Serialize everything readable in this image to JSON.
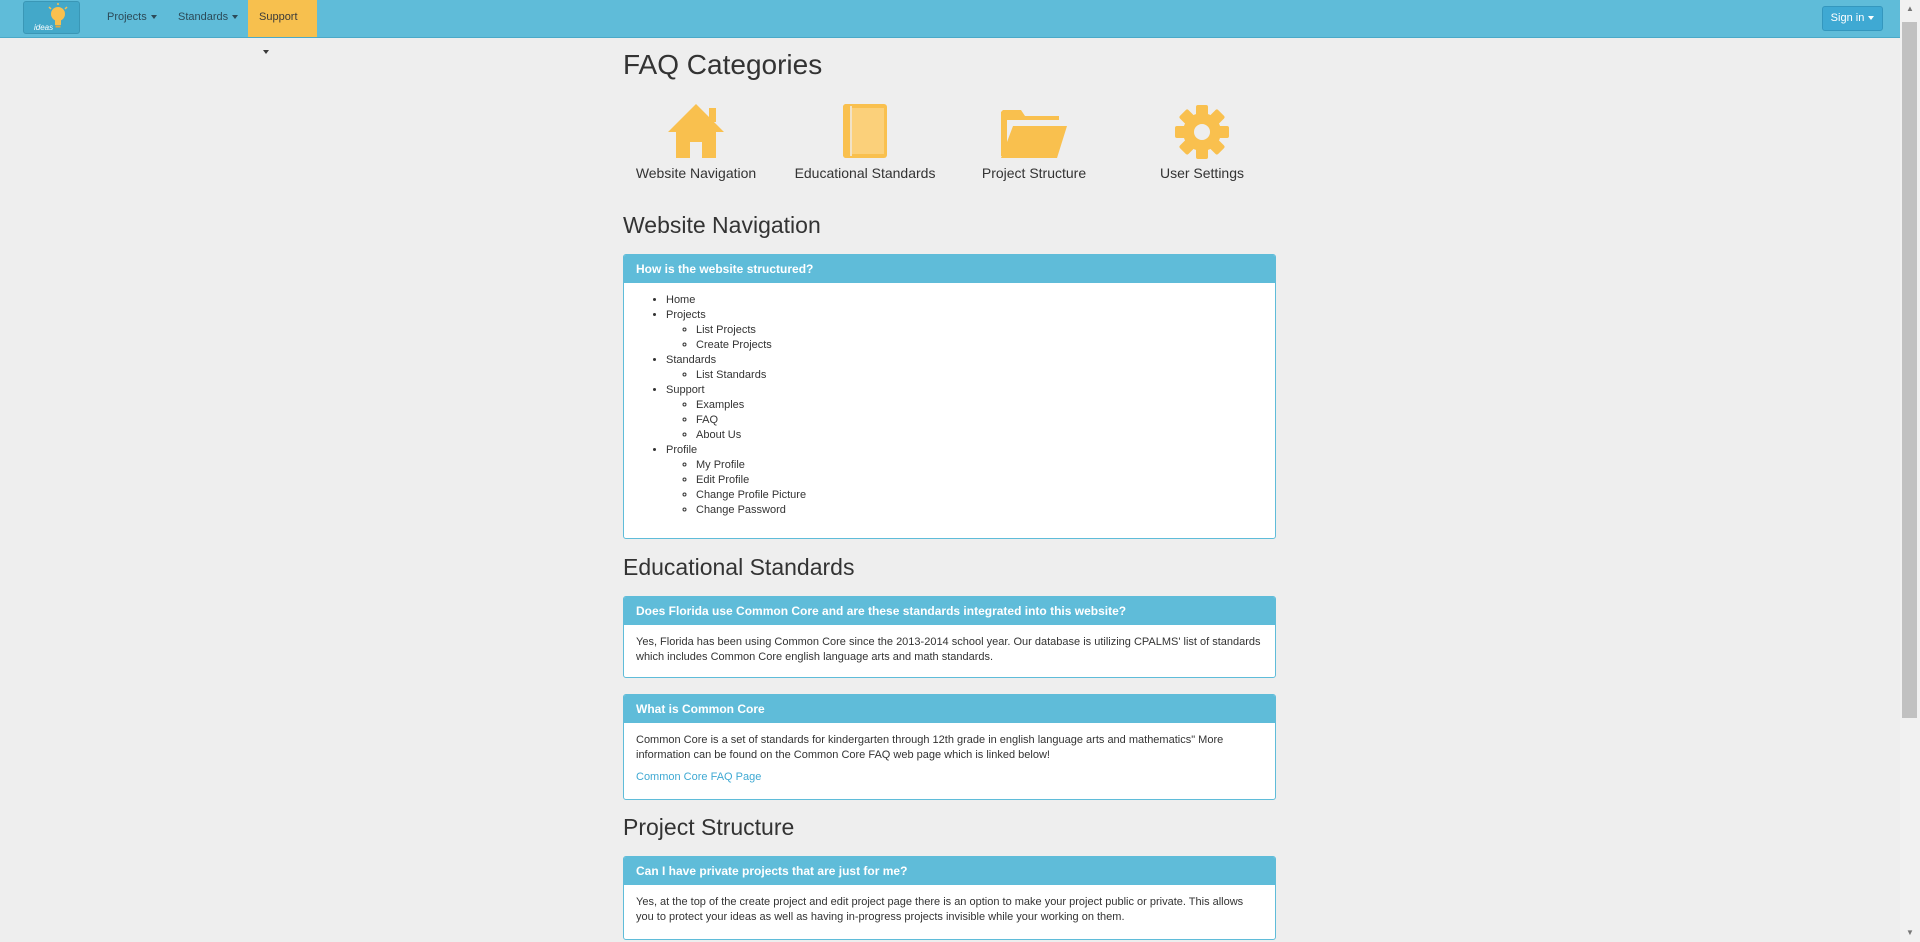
{
  "navbar": {
    "brand_text": "ideas",
    "items": [
      {
        "label": "Projects"
      },
      {
        "label": "Standards"
      },
      {
        "label": "Support"
      }
    ],
    "signin_label": "Sign in",
    "colors": {
      "bar": "#5fbcd9",
      "active": "#f7c04e"
    }
  },
  "page": {
    "title": "FAQ Categories",
    "categories": [
      {
        "label": "Website Navigation",
        "icon": "home-icon"
      },
      {
        "label": "Educational Standards",
        "icon": "book-icon"
      },
      {
        "label": "Project Structure",
        "icon": "folder-open-icon"
      },
      {
        "label": "User Settings",
        "icon": "gear-icon"
      }
    ],
    "icon_color": "#f9c04e"
  },
  "sections": {
    "nav": {
      "title": "Website Navigation",
      "q1": {
        "question": "How is the website structured?",
        "tree": {
          "home": "Home",
          "projects": "Projects",
          "list_projects": "List Projects",
          "create_projects": "Create Projects",
          "standards": "Standards",
          "list_standards": "List Standards",
          "support": "Support",
          "examples": "Examples",
          "faq": "FAQ",
          "about": "About Us",
          "profile": "Profile",
          "my_profile": "My Profile",
          "edit_profile": "Edit Profile",
          "change_picture": "Change Profile Picture",
          "change_password": "Change Password"
        }
      }
    },
    "standards": {
      "title": "Educational Standards",
      "q1": {
        "question": "Does Florida use Common Core and are these standards integrated into this website?",
        "answer": "Yes, Florida has been using Common Core since the 2013-2014 school year. Our database is utilizing CPALMS' list of standards which includes Common Core english language arts and math standards."
      },
      "q2": {
        "question": "What is Common Core",
        "answer": "Common Core is a set of standards for kindergarten through 12th grade in english language arts and mathematics\" More information can be found on the Common Core FAQ web page which is linked below!",
        "link": "Common Core FAQ Page"
      }
    },
    "projects": {
      "title": "Project Structure",
      "q1": {
        "question": "Can I have private projects that are just for me?",
        "answer": "Yes, at the top of the create project and edit project page there is an option to make your project public or private. This allows you to protect your ideas as well as having in-progress projects invisible while your working on them."
      }
    }
  }
}
